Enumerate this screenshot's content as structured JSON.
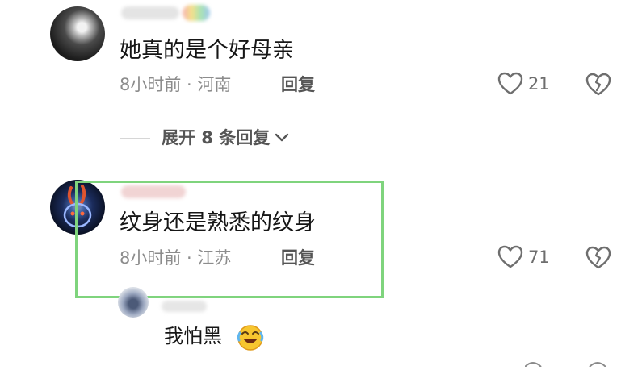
{
  "comments": [
    {
      "username": "用户",
      "text": "她真的是个好母亲",
      "meta": "8小时前 · 河南",
      "reply_label": "回复",
      "likes": "21"
    },
    {
      "username": "用户",
      "text": "纹身还是熟悉的纹身",
      "meta": "8小时前 · 江苏",
      "reply_label": "回复",
      "likes": "71"
    }
  ],
  "expand": {
    "label": "展开 8 条回复"
  },
  "reply": {
    "username": "用户",
    "text": "我怕黑",
    "emoji": "rofl-emoji"
  },
  "colors": {
    "highlight": "#7fd47d",
    "text": "#161616",
    "meta": "#8c8c8c"
  }
}
